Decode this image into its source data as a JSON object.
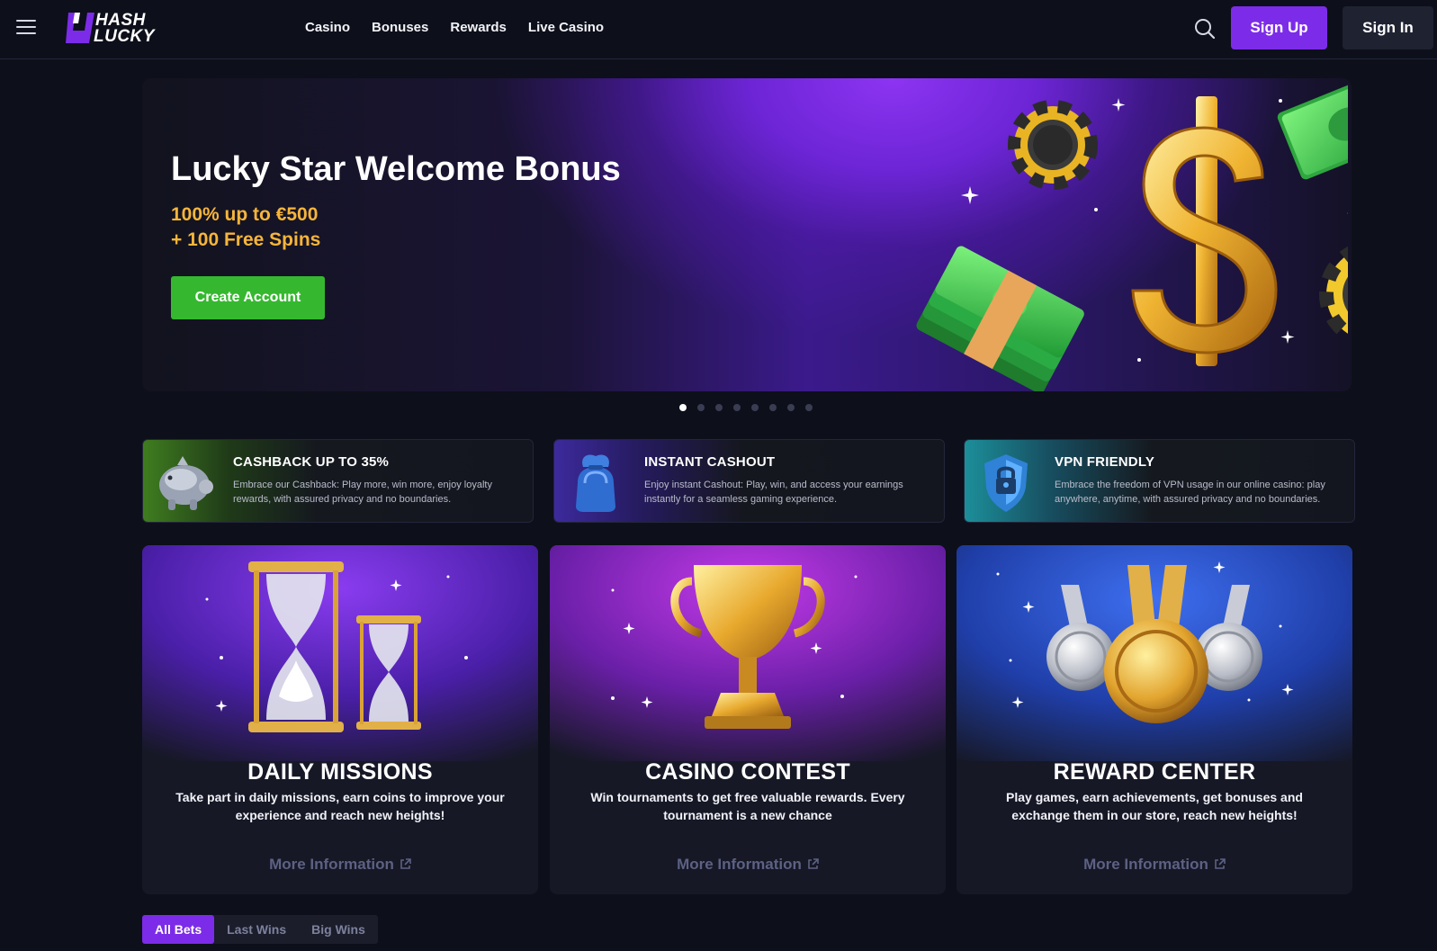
{
  "header": {
    "logo": {
      "line1": "HASH",
      "line2": "LUCKY"
    },
    "nav": [
      {
        "label": "Casino"
      },
      {
        "label": "Bonuses"
      },
      {
        "label": "Rewards"
      },
      {
        "label": "Live Casino"
      }
    ],
    "signup_label": "Sign Up",
    "signin_label": "Sign In"
  },
  "hero": {
    "title": "Lucky Star Welcome Bonus",
    "subtitle_line1": "100% up to €500",
    "subtitle_line2": "+ 100 Free Spins",
    "cta_label": "Create Account",
    "slide_count": 8,
    "active_slide": 1
  },
  "features": [
    {
      "title": "CASHBACK UP TO 35%",
      "description": "Embrace our Cashback: Play more, win more, enjoy loyalty rewards, with assured privacy and no boundaries.",
      "icon": "piggy-bank-icon"
    },
    {
      "title": "INSTANT CASHOUT",
      "description": "Enjoy instant Cashout: Play, win, and access your earnings instantly for a seamless gaming experience.",
      "icon": "money-bag-icon"
    },
    {
      "title": "VPN FRIENDLY",
      "description": "Embrace the freedom of VPN usage in our online casino: play anywhere, anytime, with assured privacy and no boundaries.",
      "icon": "shield-lock-icon"
    }
  ],
  "cards": [
    {
      "title": "DAILY MISSIONS",
      "description": "Take part in daily missions, earn coins to improve your experience and reach new heights!",
      "more_label": "More Information"
    },
    {
      "title": "CASINO CONTEST",
      "description": "Win tournaments to get free valuable rewards. Every tournament is a new chance",
      "more_label": "More Information"
    },
    {
      "title": "REWARD CENTER",
      "description": "Play games, earn achievements, get bonuses and exchange them in our store, reach new heights!",
      "more_label": "More Information"
    }
  ],
  "bet_tabs": [
    {
      "label": "All Bets",
      "active": true
    },
    {
      "label": "Last Wins",
      "active": false
    },
    {
      "label": "Big Wins",
      "active": false
    }
  ],
  "colors": {
    "accent_purple": "#7c2ce8",
    "cta_green": "#35b82f",
    "bonus_gold": "#f6b53a",
    "background": "#0d0f1a"
  }
}
